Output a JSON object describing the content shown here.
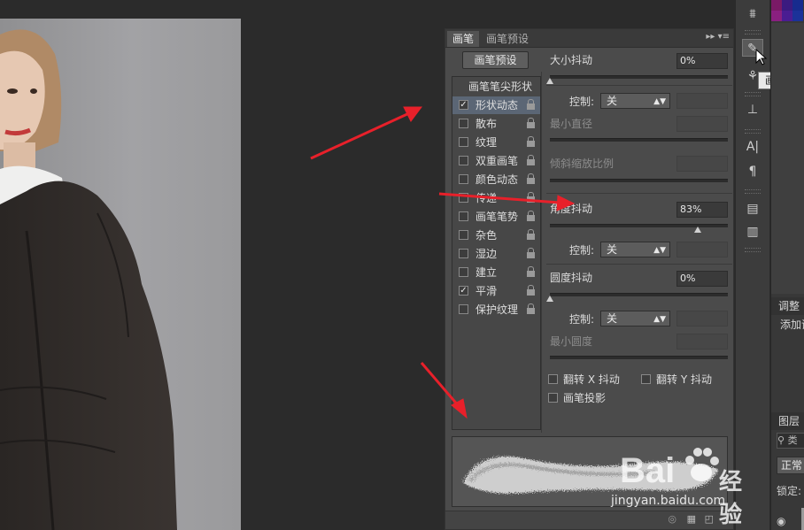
{
  "brush_panel": {
    "tabs": [
      "画笔",
      "画笔预设"
    ],
    "preset_button": "画笔预设",
    "tip_shape_header": "画笔笔尖形状",
    "options": [
      {
        "label": "形状动态",
        "checked": true,
        "selected": true
      },
      {
        "label": "散布",
        "checked": false
      },
      {
        "label": "纹理",
        "checked": false
      },
      {
        "label": "双重画笔",
        "checked": false
      },
      {
        "label": "颜色动态",
        "checked": false
      },
      {
        "label": "传递",
        "checked": false
      },
      {
        "label": "画笔笔势",
        "checked": false
      },
      {
        "label": "杂色",
        "checked": false
      },
      {
        "label": "湿边",
        "checked": false
      },
      {
        "label": "建立",
        "checked": false
      },
      {
        "label": "平滑",
        "checked": true
      },
      {
        "label": "保护纹理",
        "checked": false
      }
    ],
    "size_jitter": {
      "label": "大小抖动",
      "value": "0%",
      "level": 0.0
    },
    "control_label": "控制:",
    "control_value": "关",
    "min_diameter_label": "最小直径",
    "tilt_scale_label": "倾斜缩放比例",
    "angle_jitter": {
      "label": "角度抖动",
      "value": "83%",
      "level": 0.83
    },
    "roundness_jitter": {
      "label": "圆度抖动",
      "value": "0%",
      "level": 0.0
    },
    "min_roundness_label": "最小圆度",
    "flip_x_label": "翻转 X 抖动",
    "flip_y_label": "翻转 Y 抖动",
    "brush_projection_label": "画笔投影"
  },
  "tooltip": "画笔",
  "right_dock": {
    "adjust_label": "调整",
    "add_label": "添加调",
    "layers_label": "图层",
    "search_label": "类",
    "blend_mode": "正常",
    "lock_label": "锁定:"
  },
  "watermark": {
    "brand": "Bai",
    "brand_cn": "经验",
    "url": "jingyan.baidu.com"
  },
  "colors": {
    "arrow": "#e8202a",
    "panel": "#4b4b4b",
    "selected_row": "#5b6675"
  }
}
